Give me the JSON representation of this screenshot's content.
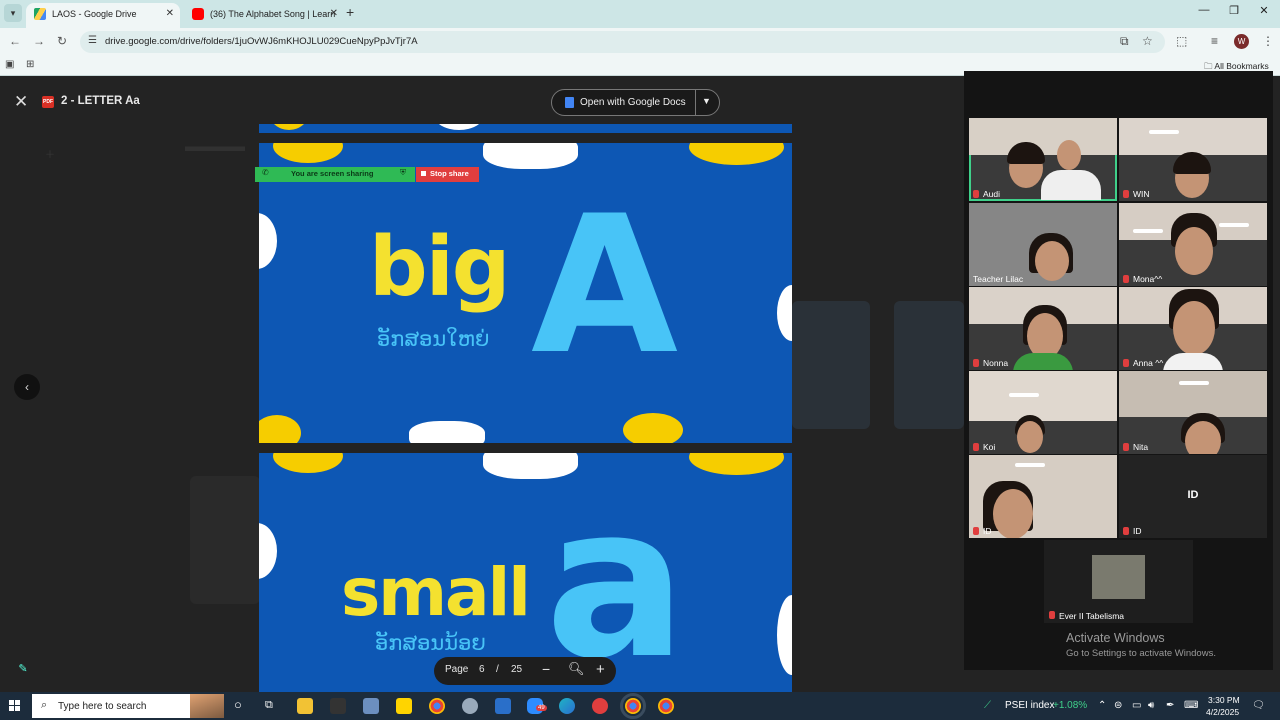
{
  "browser": {
    "tabs": [
      {
        "title": "LAOS - Google Drive",
        "active": true
      },
      {
        "title": "(36) The Alphabet Song | Learn",
        "active": false
      }
    ],
    "url": "drive.google.com/drive/folders/1juOvWJ6mKHOJLU029CueNpyPpJvTjr7A",
    "all_bookmarks": "All Bookmarks",
    "profile_initial": "W"
  },
  "viewer": {
    "doc_title": "2 - LETTER Aa",
    "pdf_badge": "PDF",
    "open_with": "Open with Google Docs"
  },
  "screen_share": {
    "sharing_label": "You are screen sharing",
    "stop_label": "Stop share"
  },
  "slides": {
    "page1_word": "big",
    "page1_lao": "ອັກສອນໃຫຍ່",
    "page1_letter": "A",
    "page2_word": "small",
    "page2_lao": "ອັກສອນນ້ອຍ",
    "page2_letter": "a"
  },
  "page_control": {
    "label": "Page",
    "current": "6",
    "separator": "/",
    "total": "25"
  },
  "participants": [
    {
      "name": "Audi",
      "muted": true,
      "active": true
    },
    {
      "name": "WIN",
      "muted": true,
      "active": false
    },
    {
      "name": "Teacher Lilac",
      "muted": false,
      "active": false
    },
    {
      "name": "Mona^^",
      "muted": true,
      "active": false
    },
    {
      "name": "Nonna",
      "muted": true,
      "active": false
    },
    {
      "name": "Anna ^^",
      "muted": true,
      "active": false
    },
    {
      "name": "Koi",
      "muted": true,
      "active": false
    },
    {
      "name": "Nita",
      "muted": true,
      "active": false
    },
    {
      "name": "ID",
      "muted": true,
      "active": false
    },
    {
      "name": "ID",
      "muted": true,
      "active": false,
      "center_label": "ID"
    }
  ],
  "host": {
    "name": "Ever II Tabelisma",
    "muted": true
  },
  "windows_notice": {
    "title": "Activate Windows",
    "subtitle": "Go to Settings to activate Windows."
  },
  "taskbar": {
    "search_placeholder": "Type here to search",
    "stock_label": "PSEI index",
    "stock_change": "+1.08%",
    "time": "3:30 PM",
    "date": "4/2/2025",
    "zoom_badge": "49"
  },
  "colors": {
    "slide_blue": "#0d57b4",
    "slide_yellow": "#f4e12f",
    "slide_cyan": "#48c4f7",
    "share_green": "#2fba55",
    "stop_red": "#e03e3e"
  }
}
